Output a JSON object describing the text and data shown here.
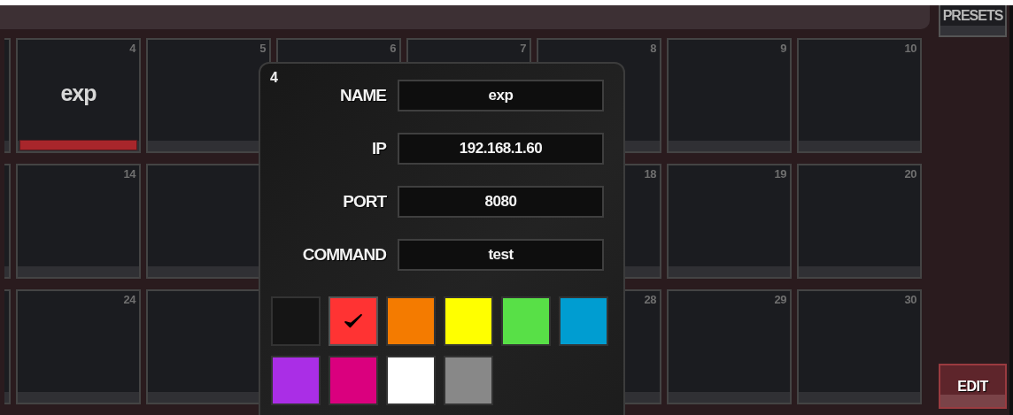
{
  "pad_rows": [
    [
      {},
      {
        "number": "4",
        "label": "exp",
        "color": "#a8262b"
      },
      {
        "number": "5"
      },
      {
        "number": "6"
      },
      {
        "number": "7"
      },
      {
        "number": "8"
      },
      {
        "number": "9"
      },
      {
        "number": "10"
      }
    ],
    [
      {},
      {
        "number": "14"
      },
      {},
      null,
      null,
      {
        "number": "18"
      },
      {
        "number": "19"
      },
      {
        "number": "20"
      }
    ],
    [
      {},
      {
        "number": "24"
      },
      {},
      null,
      null,
      {
        "number": "28"
      },
      {
        "number": "29"
      },
      {
        "number": "30"
      }
    ]
  ],
  "presets_button": "PRESETS",
  "edit_button": "EDIT",
  "editor": {
    "number": "4",
    "fields": [
      {
        "label": "NAME",
        "value": "exp"
      },
      {
        "label": "IP",
        "value": "192.168.1.60"
      },
      {
        "label": "PORT",
        "value": "8080"
      },
      {
        "label": "COMMAND",
        "value": "test"
      }
    ],
    "colors": [
      {
        "color": "#151515",
        "selected": false
      },
      {
        "color": "#ff3333",
        "selected": true
      },
      {
        "color": "#f47b00",
        "selected": false
      },
      {
        "color": "#ffff00",
        "selected": false
      },
      {
        "color": "#58e047",
        "selected": false
      },
      {
        "color": "#009dd1",
        "selected": false
      },
      {
        "color": "#aa2ee6",
        "selected": false
      },
      {
        "color": "#da007e",
        "selected": false
      },
      {
        "color": "#ffffff",
        "selected": false
      },
      {
        "color": "#888888",
        "selected": false
      }
    ]
  }
}
